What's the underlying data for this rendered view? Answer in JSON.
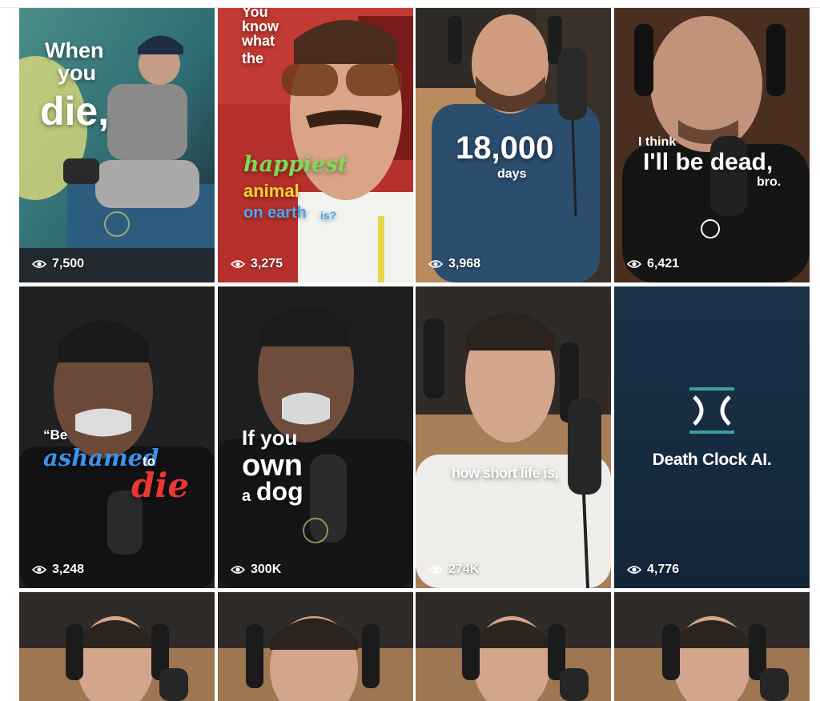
{
  "tiles": [
    {
      "views": "7,500",
      "caption": [
        "When",
        "you",
        "die,"
      ]
    },
    {
      "views": "3,275",
      "caption": [
        "You",
        "know",
        "what",
        "the",
        "happiest",
        "animal",
        "on earth",
        "is?"
      ]
    },
    {
      "views": "3,968",
      "caption": [
        "18,000",
        "days"
      ]
    },
    {
      "views": "6,421",
      "caption": [
        "I think",
        "I'll be dead,",
        "bro."
      ]
    },
    {
      "views": "3,248",
      "caption": [
        "“Be",
        "ashamed",
        "to",
        "die"
      ]
    },
    {
      "views": "300K",
      "caption": [
        "If you",
        "own",
        "a",
        "dog"
      ]
    },
    {
      "views": "274K",
      "caption": [
        "how short life is,"
      ]
    },
    {
      "views": "4,776",
      "brand": "Death Clock AI."
    },
    {
      "views": ""
    },
    {
      "views": ""
    },
    {
      "views": ""
    },
    {
      "views": ""
    }
  ],
  "icons": {
    "views": "eye-icon",
    "brand": "death-clock-logo-icon",
    "watermark": "smiley-watermark-icon"
  },
  "colors": {
    "brand_bg": "#16293d",
    "logo_teal": "#3a9ea0",
    "happiest": "#7ed957",
    "animal": "#f6d22c",
    "on_earth": "#4aa8f0",
    "ashamed": "#3c92e8",
    "die_red": "#e8382f"
  }
}
